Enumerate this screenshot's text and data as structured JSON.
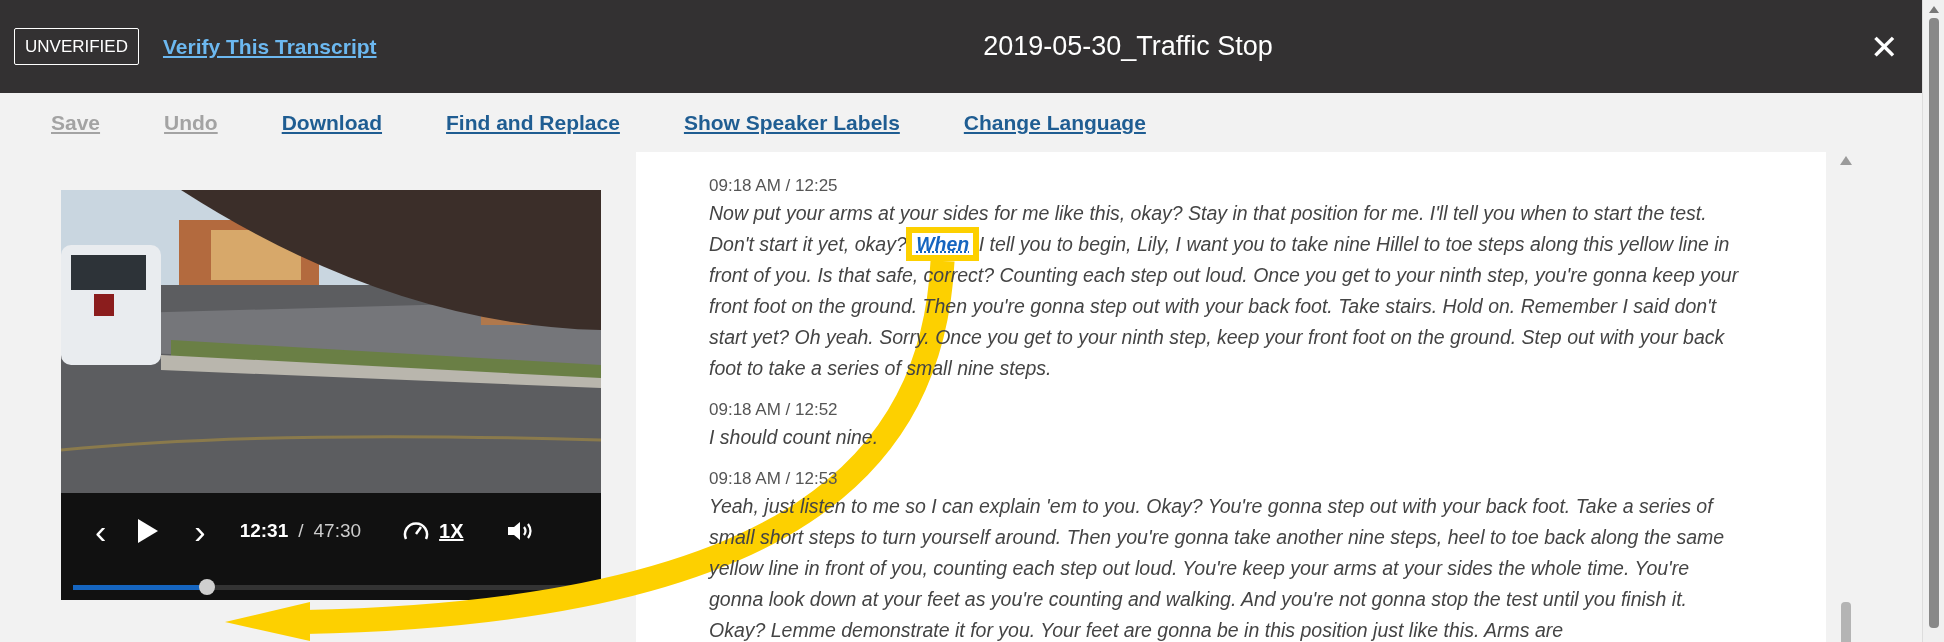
{
  "header": {
    "status_badge": "UNVERIFIED",
    "verify_link": "Verify This Transcript",
    "title": "2019-05-30_Traffic Stop",
    "close": "✕"
  },
  "toolbar": [
    {
      "label": "Save",
      "disabled": true
    },
    {
      "label": "Undo",
      "disabled": true
    },
    {
      "label": "Download",
      "disabled": false
    },
    {
      "label": "Find and Replace",
      "disabled": false
    },
    {
      "label": "Show Speaker Labels",
      "disabled": false
    },
    {
      "label": "Change Language",
      "disabled": false
    }
  ],
  "player": {
    "prev": "‹",
    "next": "›",
    "current_time": "12:31",
    "separator": "/",
    "duration": "47:30",
    "speed": "1X",
    "level": 0.26
  },
  "transcript": [
    {
      "time": "09:18 AM / 12:25",
      "segments": [
        {
          "text": "Now put your arms at your sides for me like this, okay? Stay in that position for me. I'll tell you when to start the test. Don't start it yet, okay? ",
          "current": false
        },
        {
          "text": "When",
          "current": true
        },
        {
          "text": " I tell you to begin, Lily, I want you to take nine Hillel to toe steps along this yellow line in front of you. Is that safe, correct? Counting each step out loud. Once you get to your ninth step, you're gonna keep your front foot on the ground. Then you're gonna step out with your back foot. Take stairs. Hold on. Remember I said don't start yet? Oh yeah. Sorry. Once you get to your ninth step, keep your front foot on the ground. Step out with your back foot to take a series of small nine steps.",
          "current": false
        }
      ]
    },
    {
      "time": "09:18 AM / 12:52",
      "segments": [
        {
          "text": "I should count nine.",
          "current": false
        }
      ]
    },
    {
      "time": "09:18 AM / 12:53",
      "segments": [
        {
          "text": "Yeah, just listen to me so I can explain 'em to you. Okay? You're gonna step out with your back foot. Take a series of small short steps to turn yourself around. Then you're gonna take another nine steps, heel to toe back along the same yellow line in front of you, counting each step out loud. You're keep your arms at your sides the whole time. You're gonna look down at your feet as you're counting and walking. And you're not gonna stop the test until you finish it. Okay? Lemme demonstrate it for you. Your feet are gonna be in this position just like this. Arms are",
          "current": false
        }
      ]
    }
  ]
}
